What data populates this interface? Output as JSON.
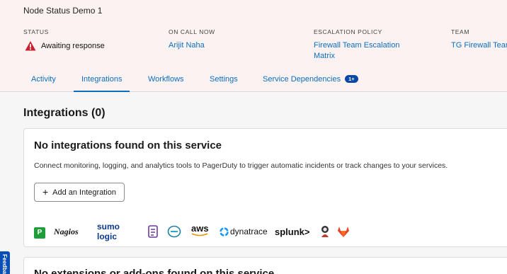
{
  "service": {
    "name": "Node Status Demo 1"
  },
  "meta": {
    "status": {
      "label": "STATUS",
      "value": "Awaiting response"
    },
    "on_call": {
      "label": "ON CALL NOW",
      "value": "Arijit Naha"
    },
    "escalation": {
      "label": "ESCALATION POLICY",
      "value_line1": "Firewall Team Escalation",
      "value_line2": "Matrix"
    },
    "team": {
      "label": "TEAM",
      "value": "TG Firewall Team"
    }
  },
  "tabs": [
    {
      "label": "Activity"
    },
    {
      "label": "Integrations",
      "active": true
    },
    {
      "label": "Workflows"
    },
    {
      "label": "Settings"
    },
    {
      "label": "Service Dependencies",
      "badge": "1+"
    }
  ],
  "integrations": {
    "title": "Integrations (0)",
    "empty_title": "No integrations found on this service",
    "description": "Connect monitoring, logging, and analytics tools to PagerDuty to trigger automatic incidents or track changes to your services.",
    "add_button": "Add an Integration",
    "logos": [
      "P",
      "Nagios",
      "sumo logic",
      "aws",
      "dynatrace",
      "splunk>"
    ]
  },
  "extensions": {
    "title_partial": "No extensions or add-ons found on this service"
  },
  "feedback": {
    "label": "Feedback"
  },
  "colors": {
    "link": "#0a6ebd",
    "warning": "#c8202f",
    "header_bg": "#fdf2f2"
  }
}
